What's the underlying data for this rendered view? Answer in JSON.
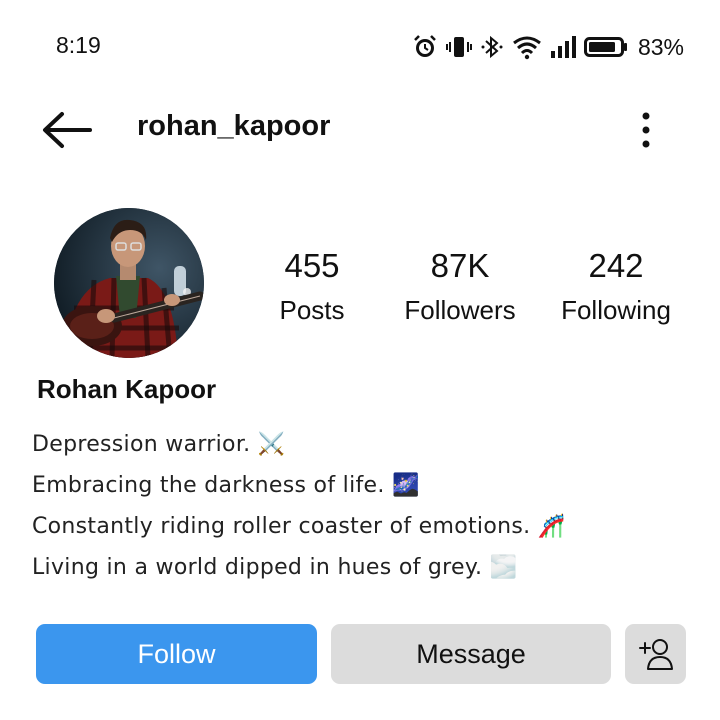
{
  "status_bar": {
    "time": "8:19",
    "battery_percent": "83%",
    "icons": [
      "alarm-icon",
      "vibrate-icon",
      "bluetooth-icon",
      "wifi-icon",
      "signal-icon",
      "battery-icon"
    ]
  },
  "header": {
    "username": "rohan_kapoor",
    "back_icon": "back-arrow-icon",
    "menu_icon": "more-vertical-icon"
  },
  "profile": {
    "display_name": "Rohan Kapoor",
    "stats": [
      {
        "value": "455",
        "label": "Posts"
      },
      {
        "value": "87K",
        "label": "Followers"
      },
      {
        "value": "242",
        "label": "Following"
      }
    ],
    "bio": [
      "Depression warrior. ⚔️",
      "Embracing the darkness of life. 🌌",
      "Constantly riding roller coaster of emotions. 🎢",
      "Living in a world dipped in hues of grey. 🌫️"
    ]
  },
  "actions": {
    "follow_label": "Follow",
    "message_label": "Message",
    "add_user_icon": "add-user-icon"
  },
  "colors": {
    "follow_button": "#3b96ee",
    "secondary_button": "#dcdcdc"
  }
}
